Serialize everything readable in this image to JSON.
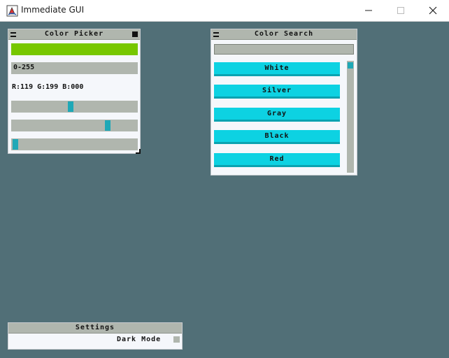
{
  "window": {
    "title": "Immediate GUI",
    "icon": "java-app-icon"
  },
  "colors": {
    "background": "#516f77",
    "panel": "#f5f7fb",
    "header": "#b0b6ae",
    "accent": "#1fa8b7",
    "result_button": "#0dd2e2"
  },
  "color_picker": {
    "title": "Color Picker",
    "preview_color": "#77c700",
    "mode_label": "0-255",
    "rgb_text": "R:119 G:199 B:000",
    "sliders": [
      {
        "channel": "R",
        "value": 119,
        "max": 255
      },
      {
        "channel": "G",
        "value": 199,
        "max": 255
      },
      {
        "channel": "B",
        "value": 0,
        "max": 255
      }
    ]
  },
  "color_search": {
    "title": "Color Search",
    "query": "",
    "results": [
      "White",
      "Silver",
      "Gray",
      "Black",
      "Red"
    ],
    "scroll_position": 0
  },
  "settings": {
    "title": "Settings",
    "dark_mode_label": "Dark Mode",
    "dark_mode_checked": false
  }
}
